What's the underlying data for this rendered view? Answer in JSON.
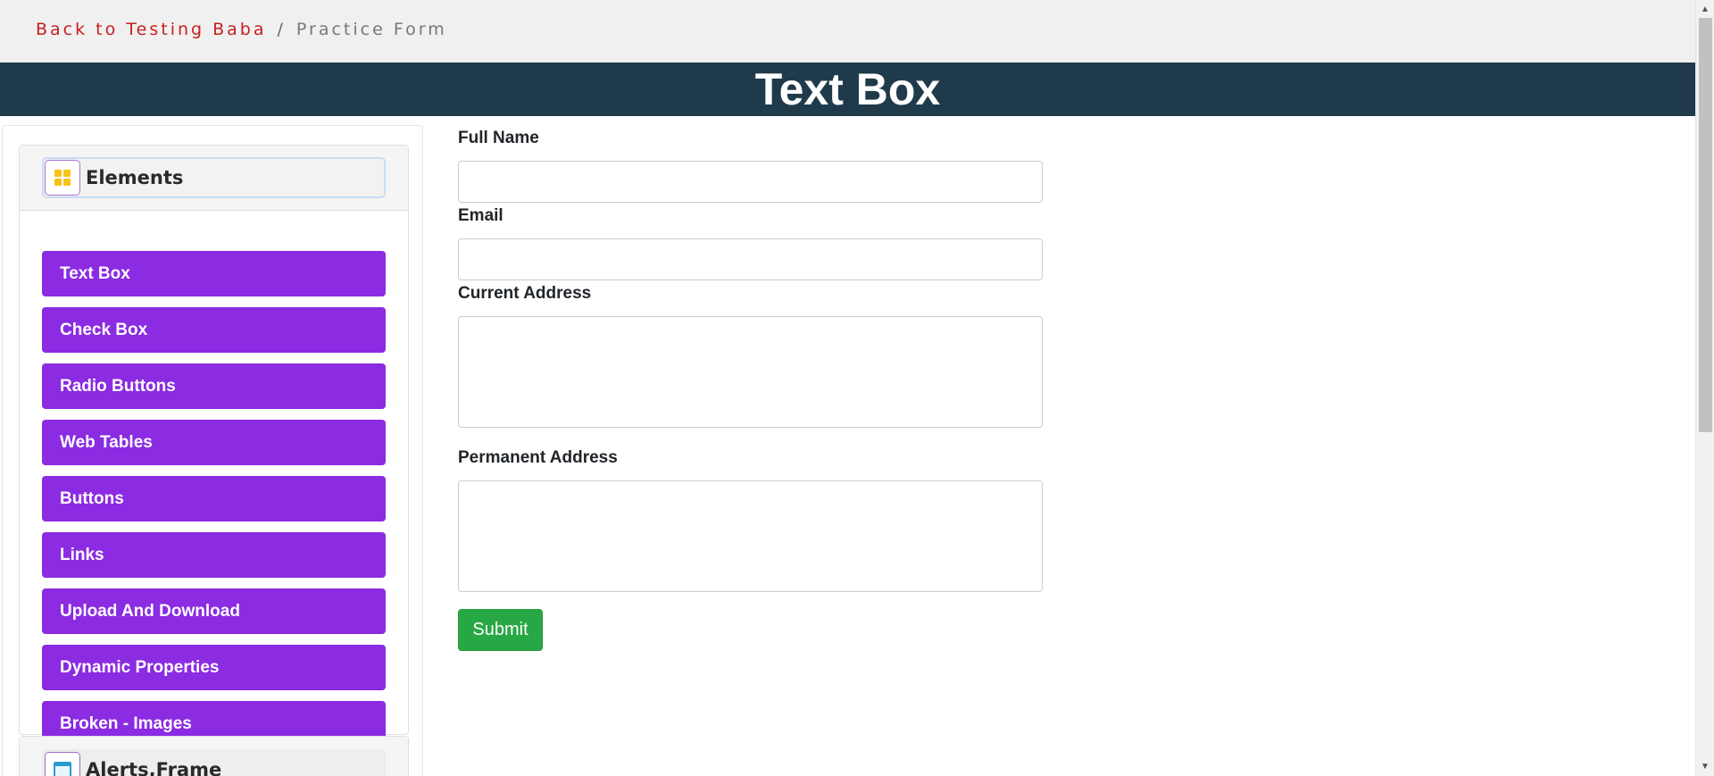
{
  "breadcrumb": {
    "home_link": "Back to Testing Baba",
    "separator": "/",
    "current": "Practice Form"
  },
  "banner": {
    "title": "Text Box"
  },
  "sidebar": {
    "groups": [
      {
        "title": "Elements",
        "icon": "grid-icon",
        "expanded": true,
        "items": [
          {
            "label": "Text Box"
          },
          {
            "label": "Check Box"
          },
          {
            "label": "Radio Buttons"
          },
          {
            "label": "Web Tables"
          },
          {
            "label": "Buttons"
          },
          {
            "label": "Links"
          },
          {
            "label": "Upload And Download"
          },
          {
            "label": "Dynamic Properties"
          },
          {
            "label": "Broken - Images"
          }
        ]
      },
      {
        "title": "Alerts,Frame",
        "icon": "window-icon",
        "expanded": false
      }
    ]
  },
  "form": {
    "full_name": {
      "label": "Full Name",
      "value": "",
      "placeholder": ""
    },
    "email": {
      "label": "Email",
      "value": "",
      "placeholder": ""
    },
    "current_address": {
      "label": "Current Address",
      "value": "",
      "placeholder": ""
    },
    "permanent_address": {
      "label": "Permanent Address",
      "value": "",
      "placeholder": ""
    },
    "submit_label": "Submit"
  },
  "colors": {
    "banner_bg": "#1f3a4a",
    "menu_item_bg": "#8b2be2",
    "submit_bg": "#28a745",
    "breadcrumb_link": "#c81e1e"
  }
}
